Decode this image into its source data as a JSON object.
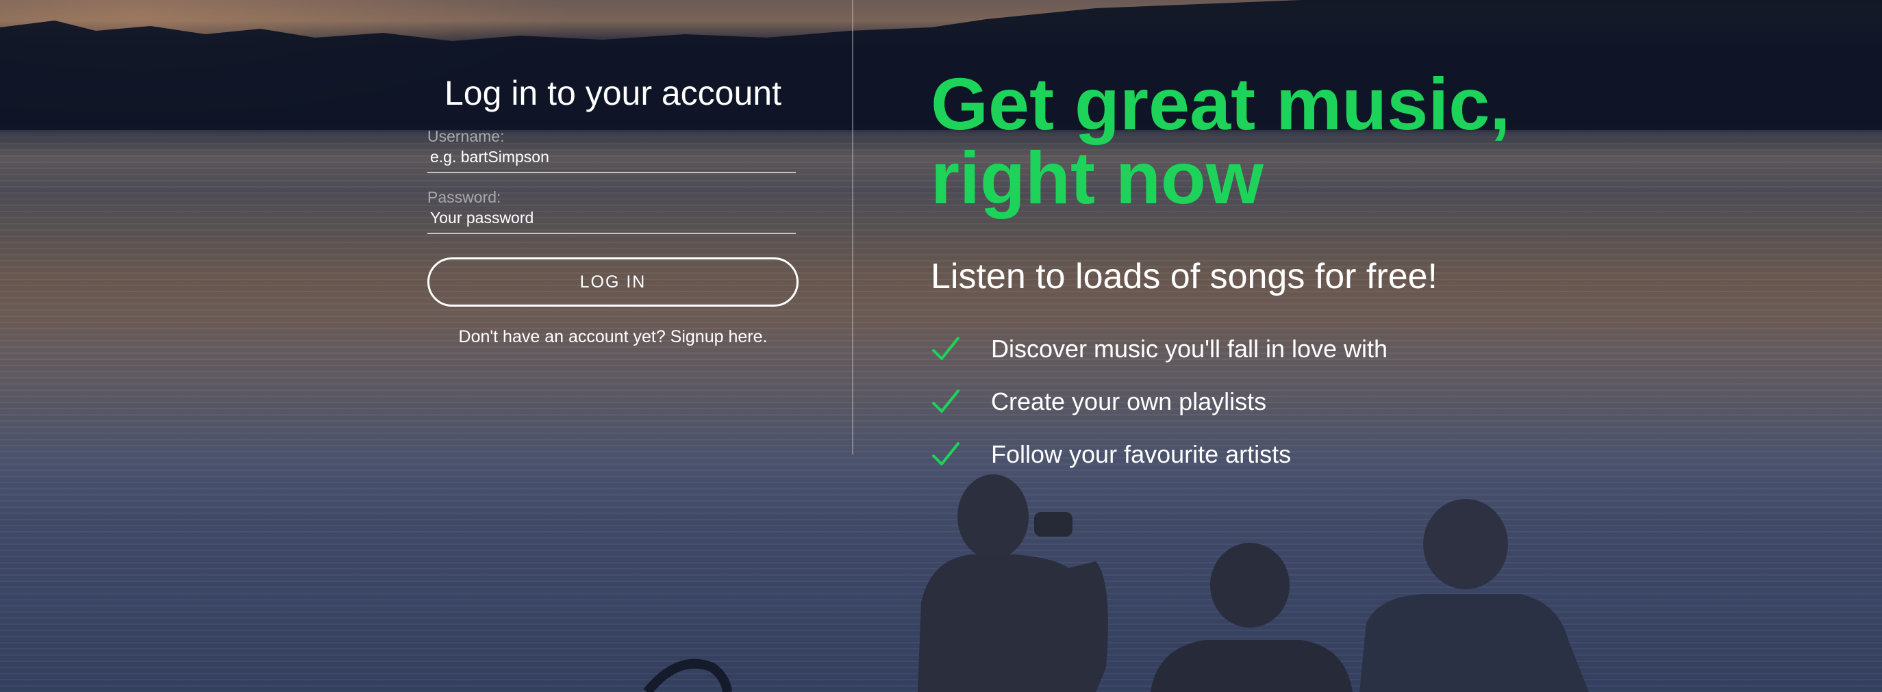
{
  "login": {
    "title": "Log in to your account",
    "username_label": "Username:",
    "username_placeholder": "e.g. bartSimpson",
    "password_label": "Password:",
    "password_placeholder": "Your password",
    "login_button": "LOG IN",
    "signup_link": "Don't have an account yet? Signup here."
  },
  "promo": {
    "headline_line1": "Get great music,",
    "headline_line2": "right now",
    "subheadline": "Listen to loads of songs for free!",
    "features": [
      "Discover music you'll fall in love with",
      "Create your own playlists",
      "Follow your favourite artists"
    ],
    "feature_icon": "check-icon"
  },
  "colors": {
    "accent": "#1ed35a",
    "text": "#ffffff",
    "label": "#a9a9ad"
  }
}
